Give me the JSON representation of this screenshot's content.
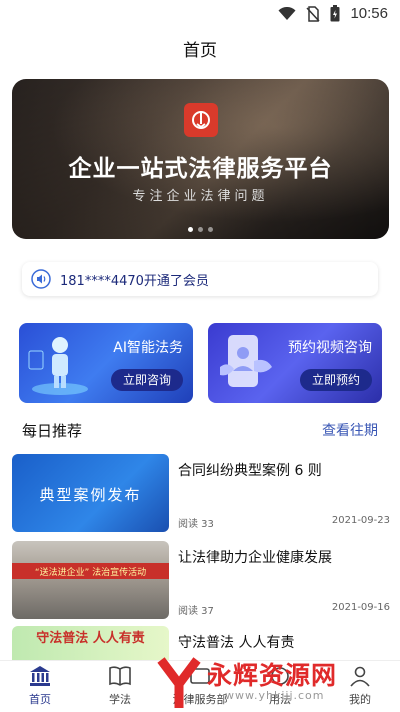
{
  "status": {
    "time": "10:56"
  },
  "header": {
    "title": "首页"
  },
  "banner": {
    "title": "企业一站式法律服务平台",
    "subtitle": "专注企业法律问题",
    "dots": 3,
    "active_dot": 0
  },
  "notice": {
    "text": "181****4470开通了会员"
  },
  "cards": [
    {
      "title": "AI智能法务",
      "button": "立即咨询"
    },
    {
      "title": "预约视频咨询",
      "button": "立即预约"
    }
  ],
  "daily": {
    "title": "每日推荐",
    "more": "查看往期"
  },
  "articles": [
    {
      "title": "合同纠纷典型案例 6 则",
      "reads": "阅读 33",
      "date": "2021-09-23",
      "thumb_text": "典型案例发布"
    },
    {
      "title": "让法律助力企业健康发展",
      "reads": "阅读 37",
      "date": "2021-09-16",
      "thumb_text": "“送法进企业” 法治宣传活动"
    },
    {
      "title": "守法普法 人人有责",
      "reads": "",
      "date": "",
      "thumb_text": "守法普法 人人有责"
    }
  ],
  "tabs": [
    {
      "label": "首页",
      "icon": "bank-icon"
    },
    {
      "label": "学法",
      "icon": "book-icon"
    },
    {
      "label": "法律服务部",
      "icon": "service-icon"
    },
    {
      "label": "用法",
      "icon": "law-icon"
    },
    {
      "label": "我的",
      "icon": "user-icon"
    }
  ],
  "watermark": {
    "brand": "永辉资源网",
    "url": "www.yhkjjj.com"
  },
  "colors": {
    "accent": "#2b3a8f",
    "link": "#3a57b5",
    "notice": "#1c2a7a",
    "logo_red": "#d93a2b"
  }
}
